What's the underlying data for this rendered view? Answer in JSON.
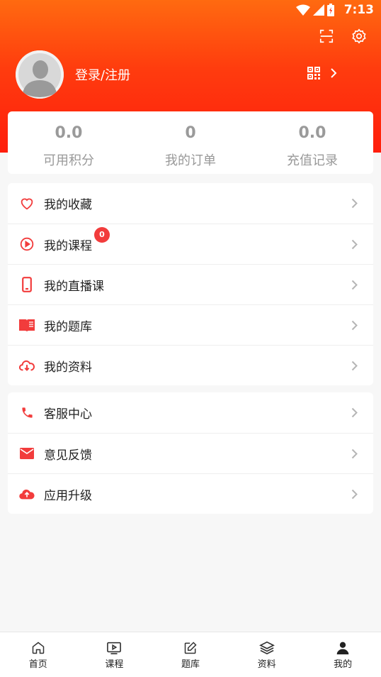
{
  "status_bar": {
    "time": "7:13"
  },
  "profile": {
    "login_label": "登录/注册"
  },
  "stats": [
    {
      "value": "0.0",
      "label": "可用积分"
    },
    {
      "value": "0",
      "label": "我的订单"
    },
    {
      "value": "0.0",
      "label": "充值记录"
    }
  ],
  "menu_primary": [
    {
      "label": "我的收藏",
      "icon": "heart-icon"
    },
    {
      "label": "我的课程",
      "icon": "play-circle-icon",
      "badge": "0"
    },
    {
      "label": "我的直播课",
      "icon": "phone-icon"
    },
    {
      "label": "我的题库",
      "icon": "book-icon"
    },
    {
      "label": "我的资料",
      "icon": "cloud-download-icon"
    }
  ],
  "menu_secondary": [
    {
      "label": "客服中心",
      "icon": "phone-call-icon"
    },
    {
      "label": "意见反馈",
      "icon": "mail-icon"
    },
    {
      "label": "应用升级",
      "icon": "cloud-upload-icon"
    }
  ],
  "tabs": [
    {
      "label": "首页",
      "icon": "home-icon"
    },
    {
      "label": "课程",
      "icon": "video-icon"
    },
    {
      "label": "题库",
      "icon": "edit-icon"
    },
    {
      "label": "资料",
      "icon": "layers-icon"
    },
    {
      "label": "我的",
      "icon": "user-icon",
      "active": true
    }
  ],
  "colors": {
    "accent": "#f23c3c",
    "header_top": "#ff6a10",
    "header_bottom": "#ff1e0c"
  }
}
